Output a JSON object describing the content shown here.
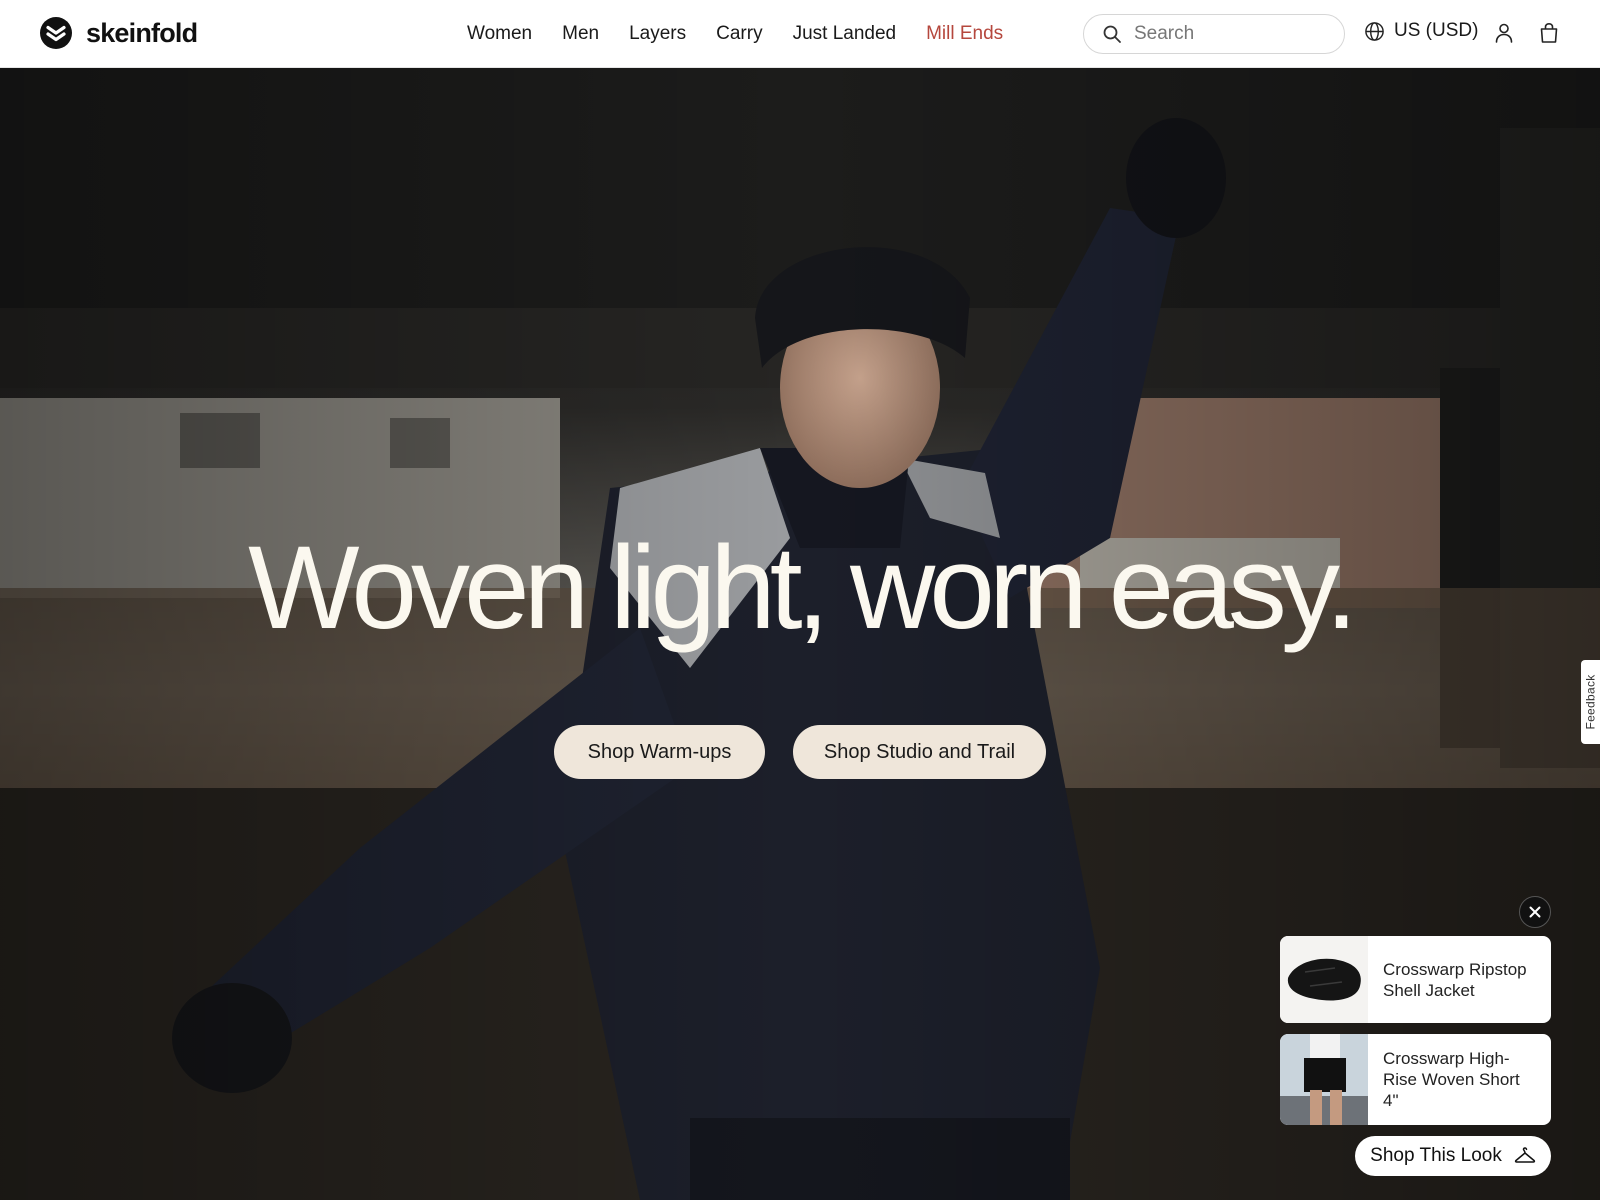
{
  "brand": {
    "name": "skeinfold",
    "logo_icon": "chevron-logo-icon"
  },
  "nav": {
    "items": [
      {
        "label": "Women"
      },
      {
        "label": "Men"
      },
      {
        "label": "Layers"
      },
      {
        "label": "Carry"
      },
      {
        "label": "Just Landed"
      },
      {
        "label": "Mill Ends",
        "color": "#b5473d"
      }
    ]
  },
  "search": {
    "placeholder": "Search",
    "value": "",
    "icon": "search-icon"
  },
  "locale": {
    "label": "US (USD)",
    "icon": "globe-icon"
  },
  "header_icons": {
    "account": "person-icon",
    "cart": "shopping-bag-icon"
  },
  "hero": {
    "headline": "Woven light, worn easy.",
    "cta_primary": "Shop Warm-ups",
    "cta_secondary": "Shop Studio and Trail",
    "button_color": "#efe6da"
  },
  "feedback": {
    "label": "Feedback"
  },
  "shop_the_look": {
    "close_icon": "close-icon",
    "products": [
      {
        "name": "Crosswarp Ripstop Shell Jacket"
      },
      {
        "name": "Crosswarp High-Rise Woven Short 4\""
      }
    ],
    "button_label": "Shop This Look",
    "button_icon": "hanger-icon"
  }
}
